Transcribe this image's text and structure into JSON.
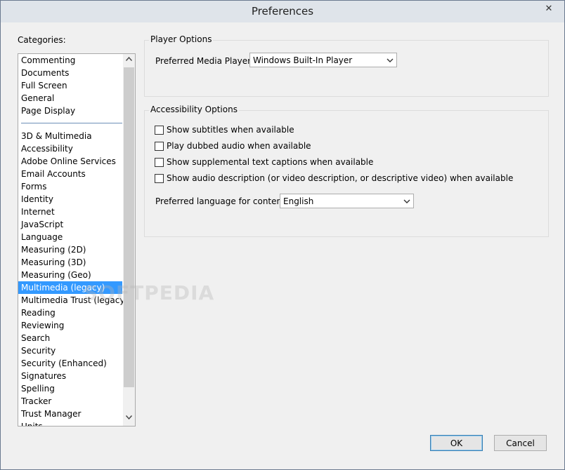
{
  "window": {
    "title": "Preferences",
    "close_glyph": "✕"
  },
  "categories": {
    "label": "Categories:",
    "items_top": [
      "Commenting",
      "Documents",
      "Full Screen",
      "General",
      "Page Display"
    ],
    "items_bottom": [
      "3D & Multimedia",
      "Accessibility",
      "Adobe Online Services",
      "Email Accounts",
      "Forms",
      "Identity",
      "Internet",
      "JavaScript",
      "Language",
      "Measuring (2D)",
      "Measuring (3D)",
      "Measuring (Geo)",
      "Multimedia (legacy)",
      "Multimedia Trust (legacy)",
      "Reading",
      "Reviewing",
      "Search",
      "Security",
      "Security (Enhanced)",
      "Signatures",
      "Spelling",
      "Tracker",
      "Trust Manager",
      "Units"
    ],
    "selected": "Multimedia (legacy)"
  },
  "player_options": {
    "title": "Player Options",
    "preferred_player_label": "Preferred Media Player:",
    "preferred_player_value": "Windows Built-In Player"
  },
  "accessibility_options": {
    "title": "Accessibility Options",
    "checkboxes": [
      {
        "label": "Show subtitles when available",
        "checked": false
      },
      {
        "label": "Play dubbed audio when available",
        "checked": false
      },
      {
        "label": "Show supplemental text captions when available",
        "checked": false
      },
      {
        "label": "Show audio description (or video description, or descriptive video) when available",
        "checked": false
      }
    ],
    "language_label": "Preferred language for content:",
    "language_value": "English"
  },
  "buttons": {
    "ok": "OK",
    "cancel": "Cancel"
  },
  "watermark": "SOFTPEDIA"
}
